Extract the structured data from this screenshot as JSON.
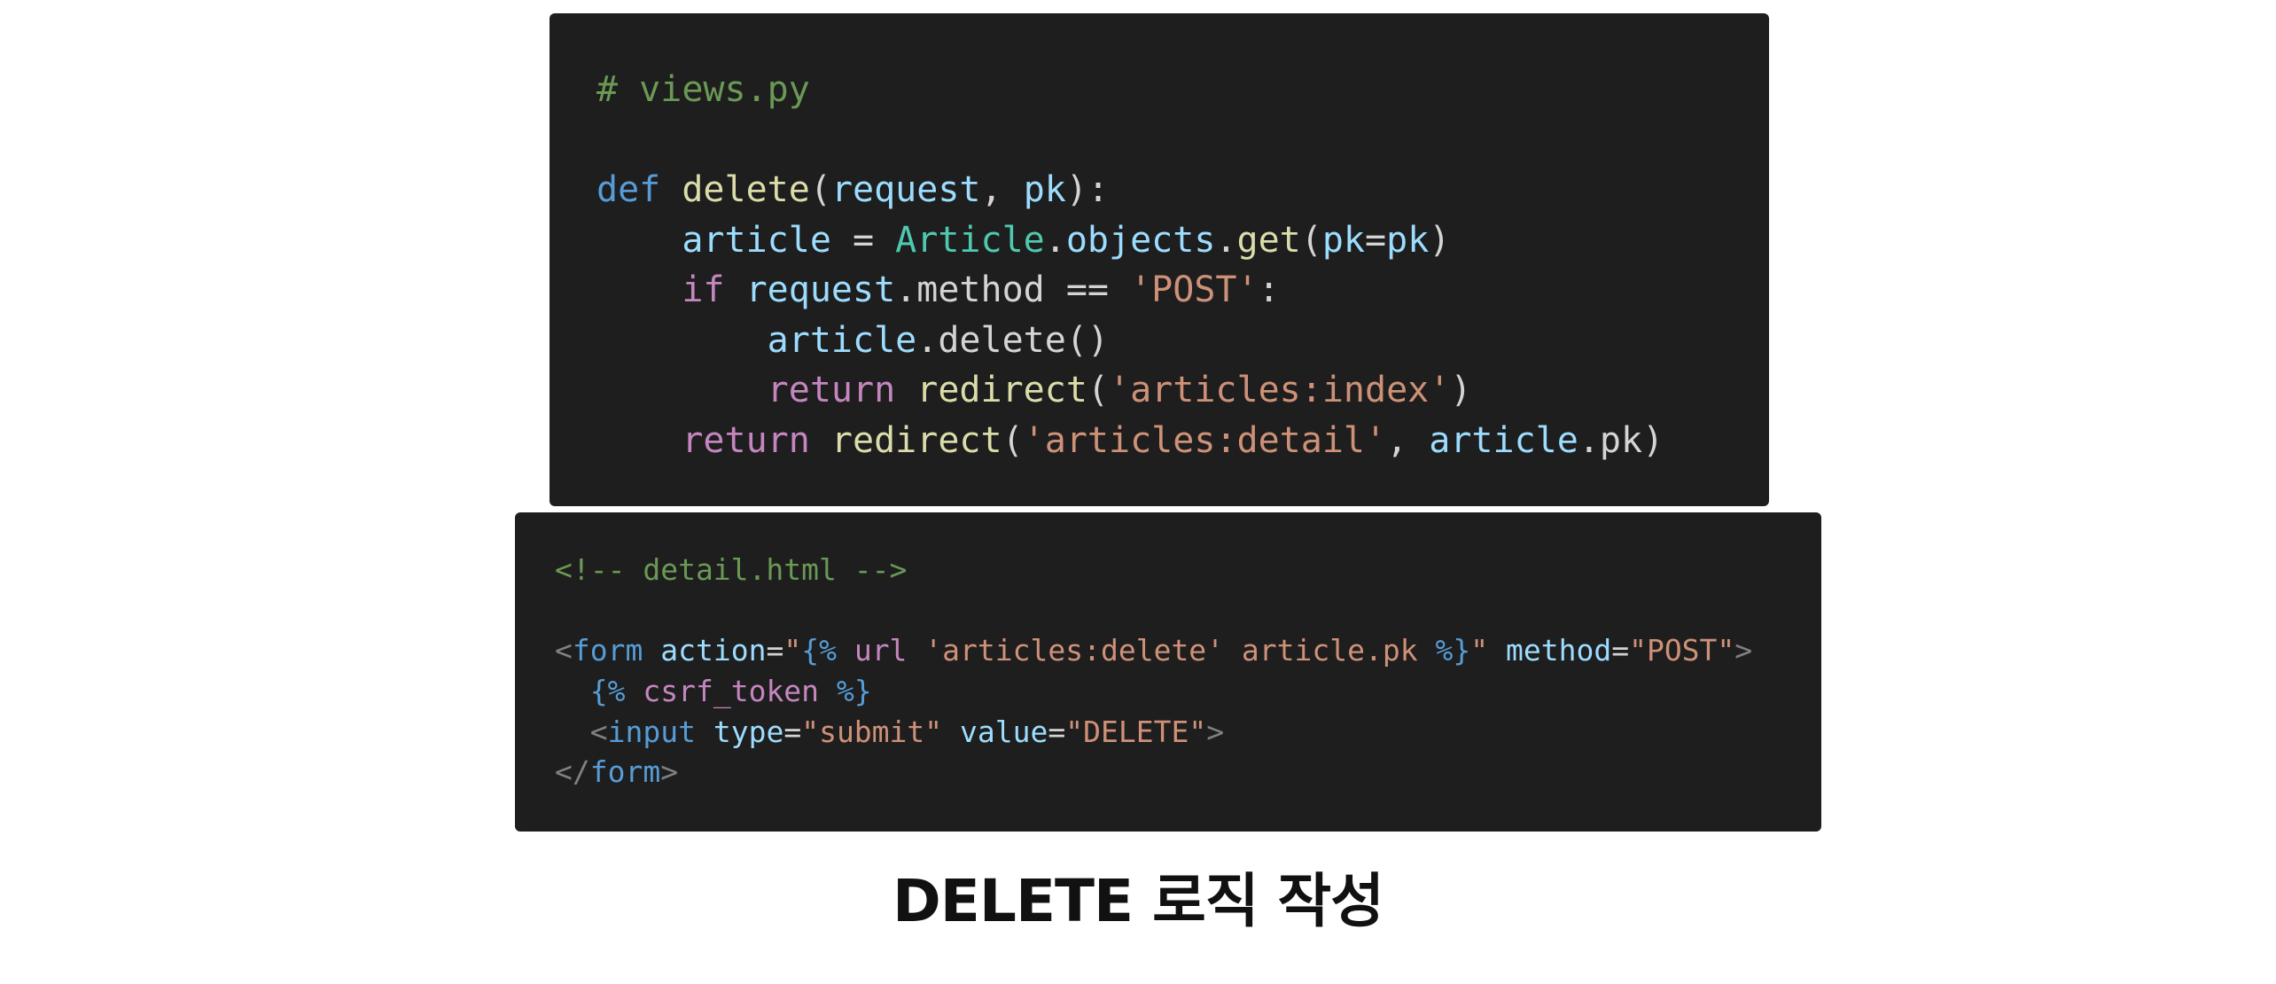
{
  "code_blocks": [
    {
      "lines": [
        [
          {
            "t": "# views.py",
            "c": "comment"
          }
        ],
        [],
        [
          {
            "t": "def",
            "c": "keyword"
          },
          {
            "t": " ",
            "c": "punct"
          },
          {
            "t": "delete",
            "c": "func"
          },
          {
            "t": "(",
            "c": "punct"
          },
          {
            "t": "request",
            "c": "var"
          },
          {
            "t": ", ",
            "c": "punct"
          },
          {
            "t": "pk",
            "c": "var"
          },
          {
            "t": "):",
            "c": "punct"
          }
        ],
        [
          {
            "t": "    ",
            "c": "punct"
          },
          {
            "t": "article",
            "c": "var"
          },
          {
            "t": " = ",
            "c": "punct"
          },
          {
            "t": "Article",
            "c": "class"
          },
          {
            "t": ".",
            "c": "punct"
          },
          {
            "t": "objects",
            "c": "var"
          },
          {
            "t": ".",
            "c": "punct"
          },
          {
            "t": "get",
            "c": "func"
          },
          {
            "t": "(",
            "c": "punct"
          },
          {
            "t": "pk",
            "c": "var"
          },
          {
            "t": "=",
            "c": "punct"
          },
          {
            "t": "pk",
            "c": "var"
          },
          {
            "t": ")",
            "c": "punct"
          }
        ],
        [
          {
            "t": "    ",
            "c": "punct"
          },
          {
            "t": "if",
            "c": "control"
          },
          {
            "t": " ",
            "c": "punct"
          },
          {
            "t": "request",
            "c": "var"
          },
          {
            "t": ".method == ",
            "c": "punct"
          },
          {
            "t": "'POST'",
            "c": "string"
          },
          {
            "t": ":",
            "c": "punct"
          }
        ],
        [
          {
            "t": "        ",
            "c": "punct"
          },
          {
            "t": "article",
            "c": "var"
          },
          {
            "t": ".delete()",
            "c": "punct"
          }
        ],
        [
          {
            "t": "        ",
            "c": "punct"
          },
          {
            "t": "return",
            "c": "control"
          },
          {
            "t": " ",
            "c": "punct"
          },
          {
            "t": "redirect",
            "c": "func"
          },
          {
            "t": "(",
            "c": "punct"
          },
          {
            "t": "'articles:index'",
            "c": "string"
          },
          {
            "t": ")",
            "c": "punct"
          }
        ],
        [
          {
            "t": "    ",
            "c": "punct"
          },
          {
            "t": "return",
            "c": "control"
          },
          {
            "t": " ",
            "c": "punct"
          },
          {
            "t": "redirect",
            "c": "func"
          },
          {
            "t": "(",
            "c": "punct"
          },
          {
            "t": "'articles:detail'",
            "c": "string"
          },
          {
            "t": ", ",
            "c": "punct"
          },
          {
            "t": "article",
            "c": "var"
          },
          {
            "t": ".pk)",
            "c": "punct"
          }
        ]
      ]
    },
    {
      "lines": [
        [
          {
            "t": "<!-- detail.html -->",
            "c": "comment"
          }
        ],
        [],
        [
          {
            "t": "<",
            "c": "tag"
          },
          {
            "t": "form",
            "c": "tagname"
          },
          {
            "t": " ",
            "c": "punct"
          },
          {
            "t": "action",
            "c": "attr"
          },
          {
            "t": "=",
            "c": "punct"
          },
          {
            "t": "\"",
            "c": "string"
          },
          {
            "t": "{%",
            "c": "tpl"
          },
          {
            "t": " url ",
            "c": "tplkw"
          },
          {
            "t": "'articles:delete'",
            "c": "string"
          },
          {
            "t": " article.pk ",
            "c": "string"
          },
          {
            "t": "%}",
            "c": "tpl"
          },
          {
            "t": "\"",
            "c": "string"
          },
          {
            "t": " ",
            "c": "punct"
          },
          {
            "t": "method",
            "c": "attr"
          },
          {
            "t": "=",
            "c": "punct"
          },
          {
            "t": "\"POST\"",
            "c": "string"
          },
          {
            "t": ">",
            "c": "tag"
          }
        ],
        [
          {
            "t": "  ",
            "c": "punct"
          },
          {
            "t": "{%",
            "c": "tpl"
          },
          {
            "t": " csrf_token ",
            "c": "tplkw"
          },
          {
            "t": "%}",
            "c": "tpl"
          }
        ],
        [
          {
            "t": "  ",
            "c": "punct"
          },
          {
            "t": "<",
            "c": "tag"
          },
          {
            "t": "input",
            "c": "tagname"
          },
          {
            "t": " ",
            "c": "punct"
          },
          {
            "t": "type",
            "c": "attr"
          },
          {
            "t": "=",
            "c": "punct"
          },
          {
            "t": "\"submit\"",
            "c": "string"
          },
          {
            "t": " ",
            "c": "punct"
          },
          {
            "t": "value",
            "c": "attr"
          },
          {
            "t": "=",
            "c": "punct"
          },
          {
            "t": "\"DELETE\"",
            "c": "string"
          },
          {
            "t": ">",
            "c": "tag"
          }
        ],
        [
          {
            "t": "</",
            "c": "tag"
          },
          {
            "t": "form",
            "c": "tagname"
          },
          {
            "t": ">",
            "c": "tag"
          }
        ]
      ]
    }
  ],
  "caption": "DELETE 로직 작성"
}
